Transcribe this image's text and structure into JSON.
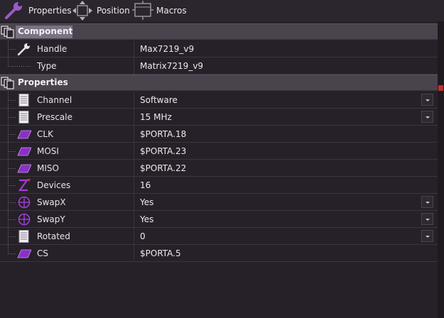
{
  "toolbar": {
    "properties_label": "Properties",
    "position_label": "Position",
    "macros_label": "Macros"
  },
  "sections": {
    "component": "Component",
    "properties": "Properties"
  },
  "component_rows": [
    {
      "name": "Handle",
      "value": "Max7219_v9",
      "icon": "wrench-icon"
    },
    {
      "name": "Type",
      "value": "Matrix7219_v9",
      "icon": "none"
    }
  ],
  "property_rows": [
    {
      "name": "Channel",
      "value": "Software",
      "icon": "list-icon",
      "dropdown": true
    },
    {
      "name": "Prescale",
      "value": "15 MHz",
      "icon": "list-icon",
      "dropdown": true
    },
    {
      "name": "CLK",
      "value": "$PORTA.18",
      "icon": "pin-icon",
      "dropdown": false
    },
    {
      "name": "MOSI",
      "value": "$PORTA.23",
      "icon": "pin-icon",
      "dropdown": false
    },
    {
      "name": "MISO",
      "value": "$PORTA.22",
      "icon": "pin-icon",
      "dropdown": false
    },
    {
      "name": "Devices",
      "value": "16",
      "icon": "integer-icon",
      "dropdown": false
    },
    {
      "name": "SwapX",
      "value": "Yes",
      "icon": "crosshair-icon",
      "dropdown": true
    },
    {
      "name": "SwapY",
      "value": "Yes",
      "icon": "crosshair-icon",
      "dropdown": true
    },
    {
      "name": "Rotated",
      "value": "0",
      "icon": "list-icon",
      "dropdown": true
    },
    {
      "name": "CS",
      "value": "$PORTA.5",
      "icon": "pin-icon",
      "dropdown": false
    }
  ],
  "colors": {
    "accent_purple": "#9b3fd0",
    "background": "#262128",
    "section_bg": "#4a434d",
    "scroll_marker": "#c03030"
  }
}
